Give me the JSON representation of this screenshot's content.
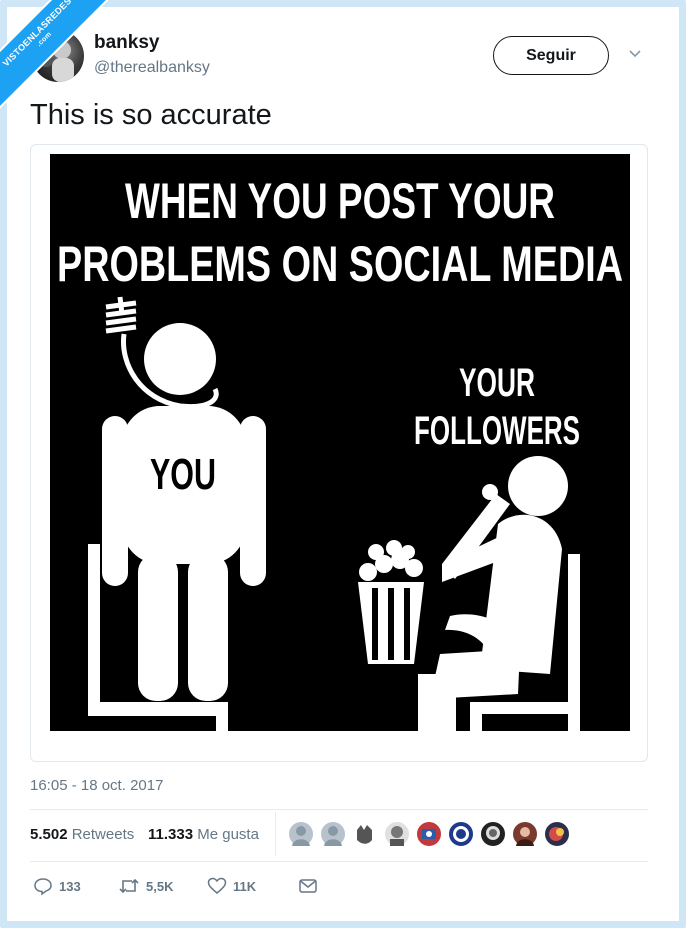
{
  "watermark": {
    "line1": "VISTOENLASREDES",
    "line2": ".com"
  },
  "author": {
    "display_name": "banksy",
    "handle": "@therealbanksy"
  },
  "follow_label": "Seguir",
  "tweet_text": "This is so accurate",
  "meme": {
    "title_line1": "WHEN YOU POST YOUR",
    "title_line2": "PROBLEMS ON SOCIAL MEDIA",
    "label_you": "YOU",
    "label_followers_1": "YOUR",
    "label_followers_2": "FOLLOWERS"
  },
  "timestamp": "16:05 - 18 oct. 2017",
  "stats": {
    "retweets_count": "5.502",
    "retweets_label": "Retweets",
    "likes_count": "11.333",
    "likes_label": "Me gusta"
  },
  "likers": [
    "avatar-1",
    "avatar-2",
    "avatar-3",
    "avatar-4",
    "avatar-5",
    "avatar-6",
    "avatar-7",
    "avatar-8",
    "avatar-9"
  ],
  "actions": {
    "replies": "133",
    "retweets": "5,5K",
    "likes": "11K"
  },
  "icons": [
    "reply-icon",
    "retweet-icon",
    "like-icon",
    "direct-message-icon",
    "chevron-down-icon"
  ],
  "colors": {
    "accent": "#1da1f2",
    "text": "#14171a",
    "muted": "#657786",
    "border": "#e6ecf0"
  }
}
